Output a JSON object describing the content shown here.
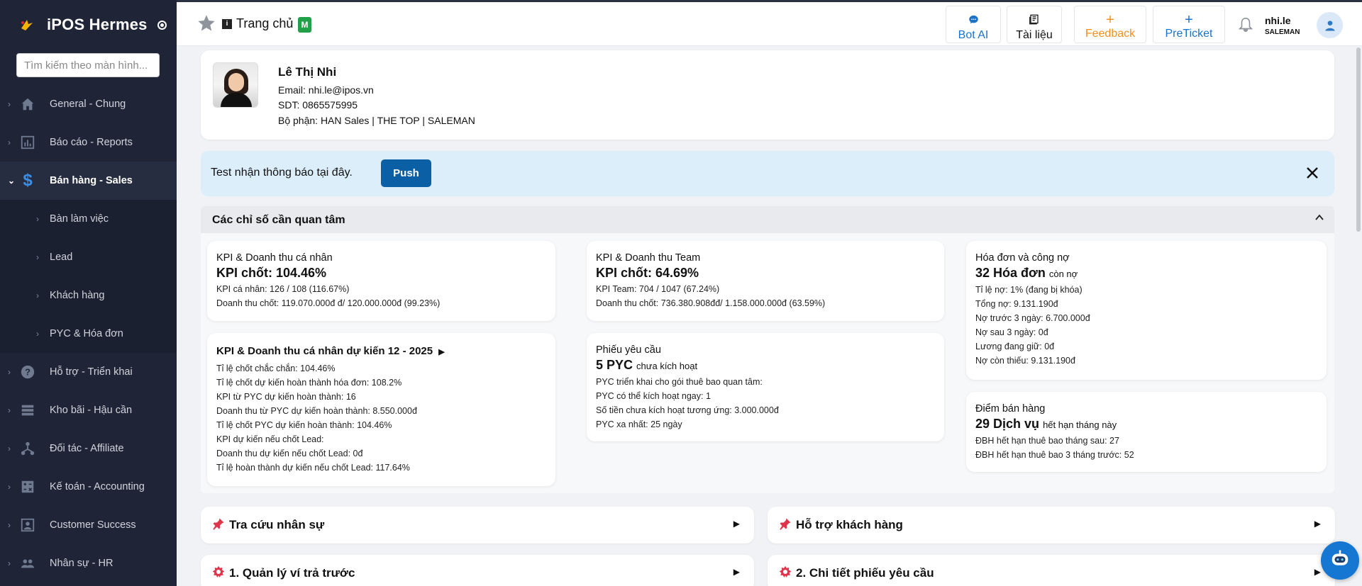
{
  "app": {
    "name": "iPOS Hermes"
  },
  "sidebar": {
    "search_placeholder": "Tìm kiếm theo màn hình...",
    "items": [
      {
        "label": "General - Chung",
        "icon": "home-icon"
      },
      {
        "label": "Báo cáo - Reports",
        "icon": "bar-chart-icon"
      },
      {
        "label": "Bán hàng - Sales",
        "icon": "dollar-icon",
        "active": true
      },
      {
        "label": "Hỗ trợ - Triển khai",
        "icon": "help-circle-icon"
      },
      {
        "label": "Kho bãi - Hậu cần",
        "icon": "warehouse-icon"
      },
      {
        "label": "Đối tác - Affiliate",
        "icon": "network-icon"
      },
      {
        "label": "Kế toán - Accounting",
        "icon": "accounting-icon"
      },
      {
        "label": "Customer Success",
        "icon": "customer-icon"
      },
      {
        "label": "Nhân sự - HR",
        "icon": "people-icon"
      }
    ],
    "sales_submenu": [
      {
        "label": "Bàn làm việc"
      },
      {
        "label": "Lead"
      },
      {
        "label": "Khách hàng"
      },
      {
        "label": "PYC & Hóa đơn"
      }
    ]
  },
  "header": {
    "breadcrumb_home": "Trang chủ",
    "badge": "M",
    "buttons": {
      "bot_ai": "Bot AI",
      "tai_lieu": "Tài liệu",
      "feedback": "Feedback",
      "preticket": "PreTicket"
    },
    "user": {
      "name": "nhi.le",
      "role": "SALEMAN"
    }
  },
  "profile": {
    "name": "Lê Thị Nhi",
    "email": "Email: nhi.le@ipos.vn",
    "phone": "SDT: 0865575995",
    "department": "Bộ phận: HAN Sales | THE TOP | SALEMAN"
  },
  "notice": {
    "text": "Test nhận thông báo tại đây.",
    "button": "Push"
  },
  "kpi": {
    "heading": "Các chỉ số cần quan tâm",
    "personal": {
      "title": "KPI & Doanh thu cá nhân",
      "headline": "KPI chốt: 104.46%",
      "lines": [
        "KPI cá nhân: 126 / 108 (116.67%)",
        "Doanh thu chốt: 119.070.000đ đ/ 120.000.000đ (99.23%)"
      ]
    },
    "team": {
      "title": "KPI & Doanh thu Team",
      "headline": "KPI chốt: 64.69%",
      "lines": [
        "KPI Team: 704 / 1047 (67.24%)",
        "Doanh thu chốt: 736.380.908đđ/ 1.158.000.000đ (63.59%)"
      ]
    },
    "invoice": {
      "title": "Hóa đơn và công nợ",
      "headline": "32 Hóa đơn",
      "headline_suffix": "còn nợ",
      "lines": [
        "Tỉ lệ nợ: 1% (đang bị khóa)",
        "Tổng nợ: 9.131.190đ",
        "Nợ trước 3 ngày: 6.700.000đ",
        "Nợ sau 3 ngày: 0đ",
        "Lương đang giữ: 0đ",
        "Nợ còn thiếu: 9.131.190đ"
      ]
    },
    "forecast": {
      "title": "KPI & Doanh thu cá nhân dự kiến 12 - 2025",
      "lines": [
        "Tỉ lệ chốt chắc chắn: 104.46%",
        "Tỉ lệ chốt dự kiến hoàn thành hóa đơn: 108.2%",
        "KPI từ PYC dự kiến hoàn thành: 16",
        "Doanh thu từ PYC dự kiến hoàn thành: 8.550.000đ",
        "Tỉ lệ chốt PYC dự kiến hoàn thành: 104.46%",
        "KPI dự kiến nếu chốt Lead:",
        "Doanh thu dự kiến nếu chốt Lead: 0đ",
        "Tỉ lệ hoàn thành dự kiến nếu chốt Lead: 117.64%"
      ]
    },
    "requests": {
      "title": "Phiếu yêu cầu",
      "headline": "5 PYC",
      "headline_suffix": "chưa kích hoạt",
      "lines": [
        "PYC triển khai cho gói thuê bao quan tâm:",
        "PYC có thể kích hoạt ngay: 1",
        "Số tiền chưa kích hoạt tương ứng: 3.000.000đ",
        "PYC xa nhất: 25 ngày"
      ]
    },
    "pos": {
      "title": "Điểm bán hàng",
      "headline": "29 Dịch vụ",
      "headline_suffix": "hết hạn tháng này",
      "lines": [
        "ĐBH hết hạn thuê bao tháng sau: 27",
        "ĐBH hết hạn thuê bao 3 tháng trước: 52"
      ]
    }
  },
  "links": [
    {
      "label": "Tra cứu nhân sự",
      "icon": "pin-icon"
    },
    {
      "label": "Hỗ trợ khách hàng",
      "icon": "pin-icon"
    },
    {
      "label": "1. Quản lý ví trả trước",
      "icon": "star-badge-icon"
    },
    {
      "label": "2. Chi tiết phiếu yêu cầu",
      "icon": "star-badge-icon"
    }
  ],
  "colors": {
    "sidebar_bg": "#1f2537",
    "accent_blue": "#0b5fa5",
    "feedback_orange": "#f0901e",
    "link_blue": "#1a73c8",
    "badge_green": "#22a04a",
    "notice_bg": "#ddeefb",
    "pin_red": "#e0344a"
  }
}
